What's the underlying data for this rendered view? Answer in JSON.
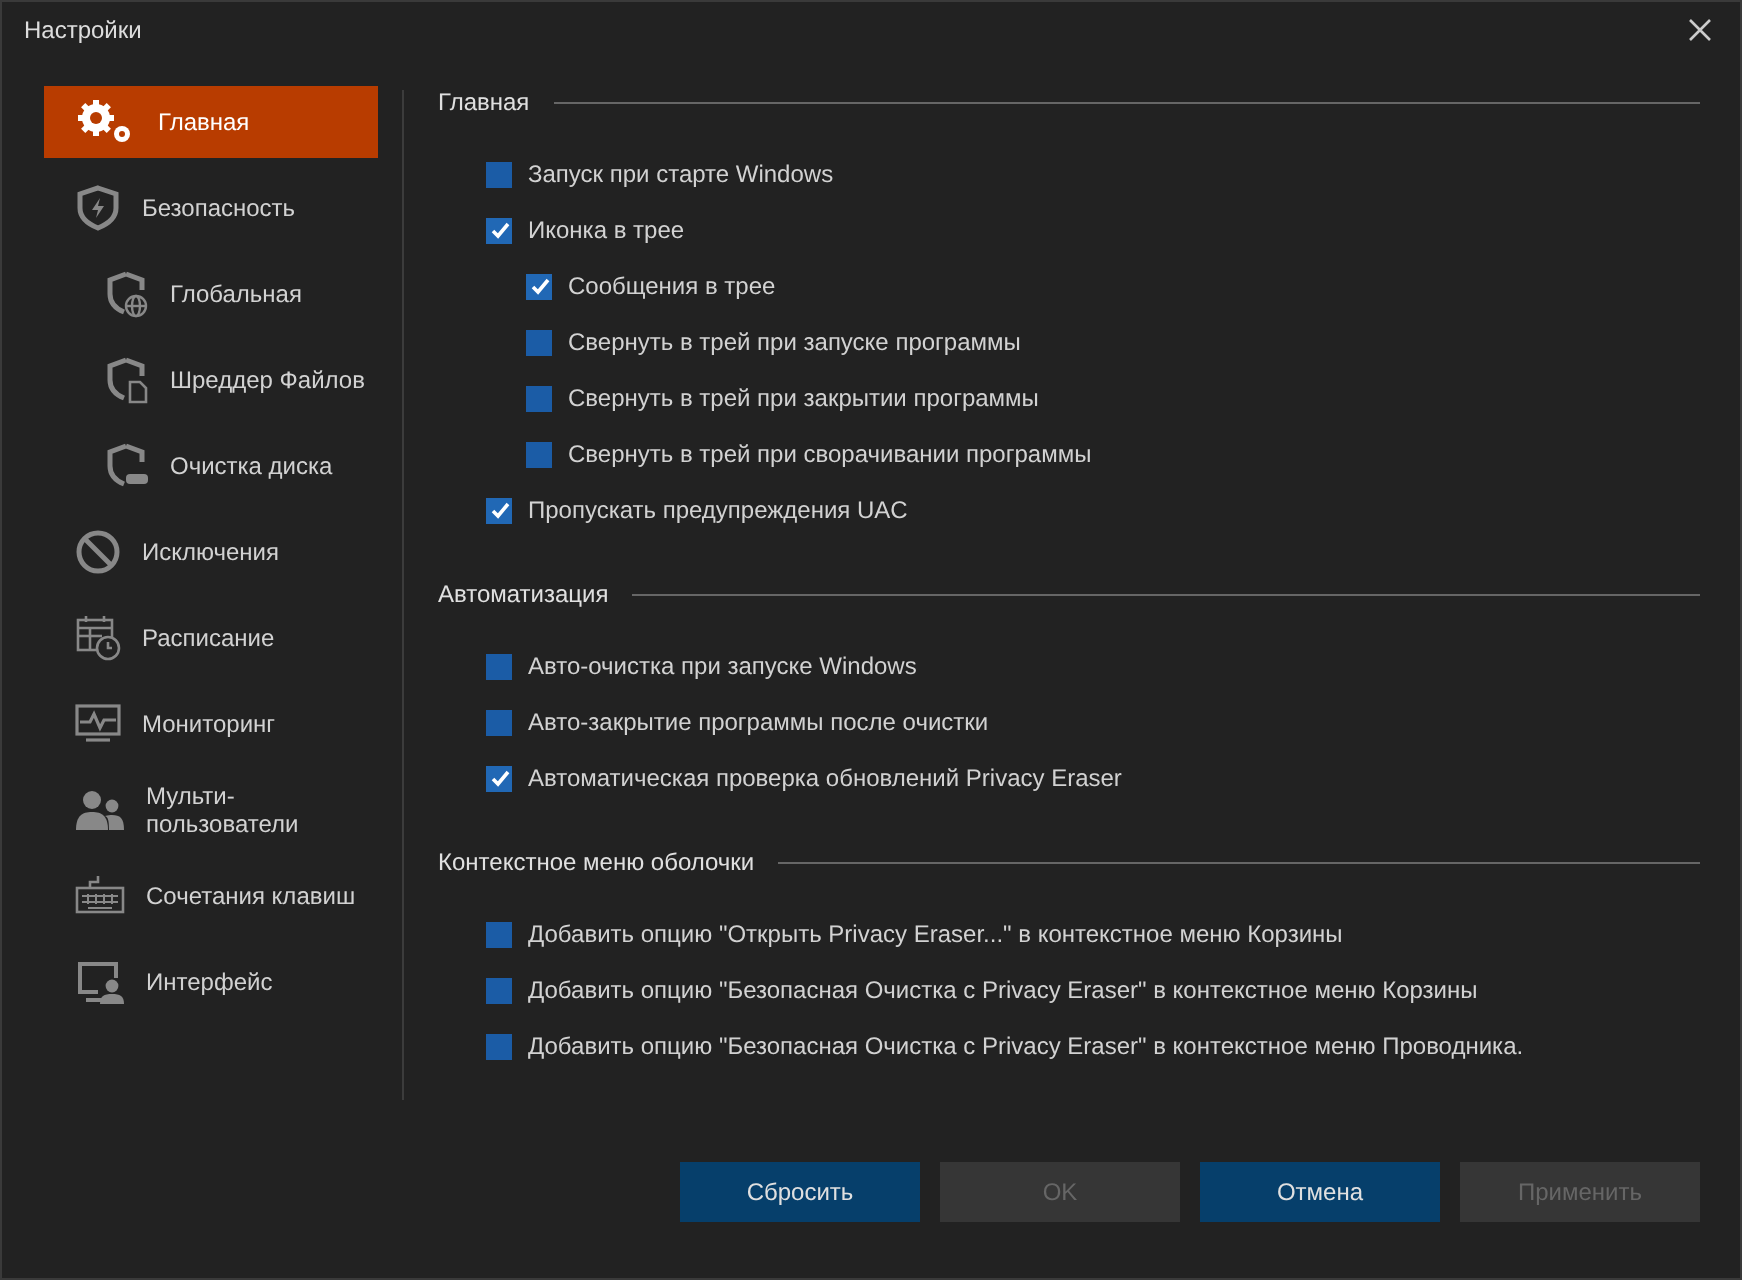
{
  "window": {
    "title": "Настройки"
  },
  "sidebar": {
    "items": [
      {
        "label": "Главная",
        "kind": "gears",
        "selected": true
      },
      {
        "label": "Безопасность",
        "kind": "shield",
        "selected": false,
        "children": [
          {
            "label": "Глобальная",
            "kind": "shield-globe",
            "selected": false
          },
          {
            "label": "Шреддер Файлов",
            "kind": "shield-file",
            "selected": false
          },
          {
            "label": "Очистка диска",
            "kind": "shield-drive",
            "selected": false
          }
        ]
      },
      {
        "label": "Исключения",
        "kind": "ban",
        "selected": false
      },
      {
        "label": "Расписание",
        "kind": "calendar",
        "selected": false
      },
      {
        "label": "Мониторинг",
        "kind": "monitor",
        "selected": false
      },
      {
        "label": "Мульти-\nпользователи",
        "kind": "users",
        "selected": false
      },
      {
        "label": "Сочетания клавиш",
        "kind": "keyboard",
        "selected": false
      },
      {
        "label": "Интерфейс",
        "kind": "desktop",
        "selected": false
      }
    ]
  },
  "sections": [
    {
      "title": "Главная",
      "options": [
        {
          "label": "Запуск при старте Windows",
          "checked": false
        },
        {
          "label": "Иконка в трее",
          "checked": true,
          "children": [
            {
              "label": "Сообщения в трее",
              "checked": true
            },
            {
              "label": "Свернуть в трей при запуске программы",
              "checked": false
            },
            {
              "label": "Свернуть в трей при закрытии программы",
              "checked": false
            },
            {
              "label": "Свернуть в трей при сворачивании программы",
              "checked": false
            }
          ]
        },
        {
          "label": "Пропускать предупреждения UAC",
          "checked": true
        }
      ]
    },
    {
      "title": "Автоматизация",
      "options": [
        {
          "label": "Авто-очистка при запуске Windows",
          "checked": false
        },
        {
          "label": "Авто-закрытие программы после очистки",
          "checked": false
        },
        {
          "label": "Автоматическая проверка обновлений Privacy Eraser",
          "checked": true
        }
      ]
    },
    {
      "title": "Контекстное меню оболочки",
      "options": [
        {
          "label": "Добавить опцию \"Открыть Privacy Eraser...\" в контекстное меню Корзины",
          "checked": false
        },
        {
          "label": "Добавить опцию \"Безопасная Очистка с Privacy Eraser\" в контекстное меню Корзины",
          "checked": false
        },
        {
          "label": "Добавить опцию \"Безопасная Очистка с Privacy Eraser\" в контекстное меню Проводника.",
          "checked": false
        }
      ]
    }
  ],
  "buttons": [
    {
      "label": "Сбросить",
      "disabled": false
    },
    {
      "label": "OK",
      "disabled": true
    },
    {
      "label": "Отмена",
      "disabled": false
    },
    {
      "label": "Применить",
      "disabled": true
    }
  ]
}
